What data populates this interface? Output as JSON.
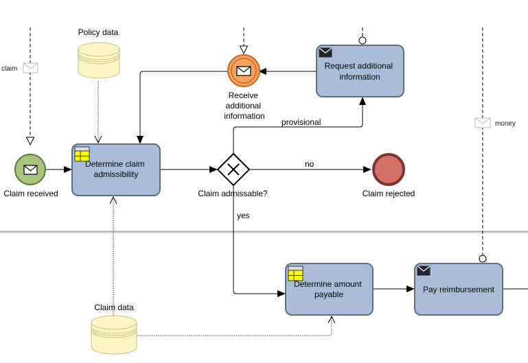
{
  "diagram": {
    "type": "BPMN process",
    "lanes": [
      "upper-lane",
      "lower-lane"
    ],
    "events": {
      "claim_received": {
        "label": "Claim received",
        "type": "message start event"
      },
      "receive_info": {
        "label_lines": [
          "Receive",
          "additional",
          "information"
        ],
        "type": "intermediate message catch event"
      },
      "claim_rejected": {
        "label": "Claim rejected",
        "type": "end event"
      }
    },
    "tasks": {
      "determine_admissibility": {
        "label_lines": [
          "Determine claim",
          "admissibility"
        ],
        "marker": "business-rule-table-icon"
      },
      "request_info": {
        "label_lines": [
          "Request additional",
          "information"
        ],
        "marker": "send-envelope-icon"
      },
      "determine_amount": {
        "label_lines": [
          "Determine amount",
          "payable"
        ],
        "marker": "business-rule-table-icon"
      },
      "pay_reimbursement": {
        "label_lines": [
          "Pay reimbursement"
        ],
        "marker": "send-envelope-icon"
      }
    },
    "gateway": {
      "label": "Claim admissable?",
      "type": "exclusive gateway"
    },
    "data_stores": {
      "policy": {
        "label": "Policy data"
      },
      "claim": {
        "label": "Claim data"
      }
    },
    "flow_labels": {
      "provisional": "provisional",
      "no": "no",
      "yes": "yes"
    },
    "messages": {
      "claim": "claim",
      "money": "money"
    },
    "colors": {
      "task_fill": "#a9bdd8",
      "task_stroke": "#5d6f86",
      "start_fill": "#a8c47e",
      "start_stroke": "#5d7a34",
      "intermediate_fill": "#f3a15b",
      "intermediate_stroke": "#c56a24",
      "end_fill": "#d4706a",
      "end_stroke": "#7a3530",
      "datastore_fill": "#fdf6c2",
      "datastore_stroke": "#c8c08a",
      "table_yellow": "#ffff00",
      "lane_divider": "#a9a9a9"
    }
  }
}
